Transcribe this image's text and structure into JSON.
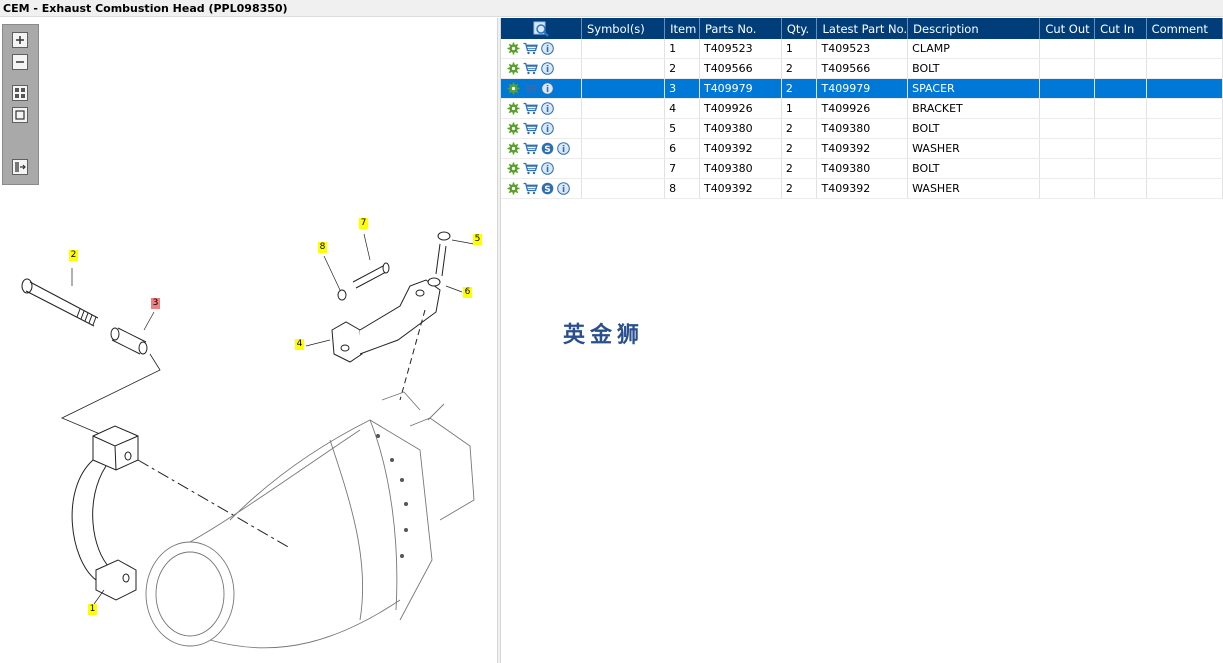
{
  "window": {
    "title": "CEM - Exhaust Combustion Head (PPL098350)"
  },
  "toolbar": {
    "buttons": [
      "zoom-in",
      "zoom-out",
      "fit-all",
      "fit-page",
      "export"
    ]
  },
  "diagram": {
    "callouts": [
      {
        "label": "1"
      },
      {
        "label": "2"
      },
      {
        "label": "3"
      },
      {
        "label": "4"
      },
      {
        "label": "5"
      },
      {
        "label": "6"
      },
      {
        "label": "7"
      },
      {
        "label": "8"
      }
    ]
  },
  "table": {
    "headers": [
      "Symbol(s)",
      "Item",
      "Parts No.",
      "Qty.",
      "Latest Part No.",
      "Description",
      "Cut Out",
      "Cut In",
      "Comment"
    ],
    "rows": [
      {
        "item": "1",
        "part": "T409523",
        "qty": "1",
        "latest": "T409523",
        "desc": "CLAMP",
        "cut_out": "",
        "cut_in": "",
        "comment": "",
        "icons": [
          "gear-icon",
          "cart-icon",
          "info-icon"
        ]
      },
      {
        "item": "2",
        "part": "T409566",
        "qty": "2",
        "latest": "T409566",
        "desc": "BOLT",
        "cut_out": "",
        "cut_in": "",
        "comment": "",
        "icons": [
          "gear-icon",
          "cart-icon",
          "info-icon"
        ]
      },
      {
        "item": "3",
        "part": "T409979",
        "qty": "2",
        "latest": "T409979",
        "desc": "SPACER",
        "cut_out": "",
        "cut_in": "",
        "comment": "",
        "icons": [
          "gear-icon",
          "cart-icon",
          "info-icon"
        ]
      },
      {
        "item": "4",
        "part": "T409926",
        "qty": "1",
        "latest": "T409926",
        "desc": "BRACKET",
        "cut_out": "",
        "cut_in": "",
        "comment": "",
        "icons": [
          "gear-icon",
          "cart-icon",
          "info-icon"
        ]
      },
      {
        "item": "5",
        "part": "T409380",
        "qty": "2",
        "latest": "T409380",
        "desc": "BOLT",
        "cut_out": "",
        "cut_in": "",
        "comment": "",
        "icons": [
          "gear-icon",
          "cart-icon",
          "info-icon"
        ]
      },
      {
        "item": "6",
        "part": "T409392",
        "qty": "2",
        "latest": "T409392",
        "desc": "WASHER",
        "cut_out": "",
        "cut_in": "",
        "comment": "",
        "icons": [
          "gear-icon",
          "cart-icon",
          "s-icon",
          "info-icon"
        ]
      },
      {
        "item": "7",
        "part": "T409380",
        "qty": "2",
        "latest": "T409380",
        "desc": "BOLT",
        "cut_out": "",
        "cut_in": "",
        "comment": "",
        "icons": [
          "gear-icon",
          "cart-icon",
          "info-icon"
        ]
      },
      {
        "item": "8",
        "part": "T409392",
        "qty": "2",
        "latest": "T409392",
        "desc": "WASHER",
        "cut_out": "",
        "cut_in": "",
        "comment": "",
        "icons": [
          "gear-icon",
          "cart-icon",
          "s-icon",
          "info-icon"
        ]
      }
    ],
    "selected_item": "3"
  },
  "watermark": {
    "text": "英金狮"
  },
  "colors": {
    "header": "#003d79",
    "selected_row": "#0078d7",
    "callout": "#ffff00",
    "callout_selected": "#f08080",
    "watermark": "#2a4f8e"
  }
}
